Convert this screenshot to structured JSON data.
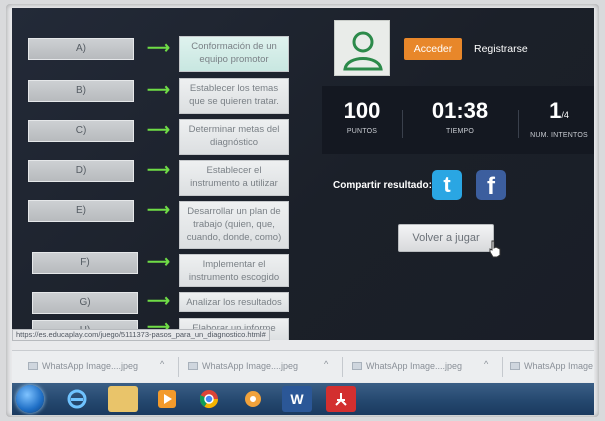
{
  "rows": [
    {
      "left": "A)",
      "right": "Conformación de un equipo promotor"
    },
    {
      "left": "B)",
      "right": "Establecer los temas que se quieren tratar."
    },
    {
      "left": "C)",
      "right": "Determinar metas del diagnóstico"
    },
    {
      "left": "D)",
      "right": "Establecer el instrumento a utilizar"
    },
    {
      "left": "E)",
      "right": "Desarrollar un plan de trabajo (quien, que, cuando, donde, como)"
    },
    {
      "left": "F)",
      "right": "Implementar el instrumento escogido"
    },
    {
      "left": "G)",
      "right": "Analizar los resultados"
    },
    {
      "left": "H)",
      "right": "Elaborar un informe para"
    }
  ],
  "arrow_glyph": "⟶",
  "user": {
    "login_label": "Acceder",
    "register_label": "Registrarse"
  },
  "stats": {
    "points_value": "100",
    "points_label": "PUNTOS",
    "time_value": "01:38",
    "time_label": "TIEMPO",
    "attempts_value": "1",
    "attempts_total": "/4",
    "attempts_label": "NUM. INTENTOS"
  },
  "share": {
    "label": "Compartir resultado:",
    "twitter_glyph": "t",
    "facebook_glyph": "f"
  },
  "replay_label": "Volver a jugar",
  "status_url": "https://es.educaplay.com/juego/5111373-pasos_para_un_diagnostico.html#",
  "downloads": [
    "WhatsApp Image....jpeg",
    "WhatsApp Image....jpeg",
    "WhatsApp Image....jpeg",
    "WhatsApp Image"
  ],
  "colors": {
    "accent_orange": "#e8872a",
    "arrow_green": "#6fdc46",
    "twitter": "#2aa6e3",
    "facebook": "#3c5e9e"
  }
}
